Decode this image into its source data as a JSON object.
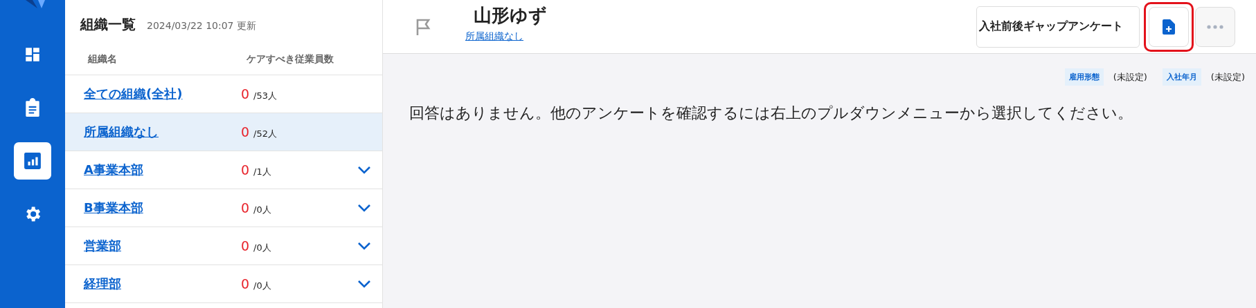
{
  "nav": [
    {
      "kind": "dashboard",
      "selected": false
    },
    {
      "kind": "clipboard",
      "selected": false
    },
    {
      "kind": "chart",
      "selected": true
    },
    {
      "kind": "settings",
      "selected": false
    }
  ],
  "org_list": {
    "title": "組織一覧",
    "updated": "2024/03/22 10:07 更新",
    "columns": [
      "組織名",
      "ケアすべき従業員数"
    ],
    "rows": [
      {
        "name": "全ての組織(全社)",
        "count": "0",
        "total": "/53人",
        "selected": false,
        "kind": "leaf"
      },
      {
        "name": "所属組織なし",
        "count": "0",
        "total": "/52人",
        "selected": true,
        "kind": "leaf"
      },
      {
        "name": "A事業本部",
        "count": "0",
        "total": "/1人",
        "selected": false,
        "kind": "group",
        "expanded": false
      },
      {
        "name": "B事業本部",
        "count": "0",
        "total": "/0人",
        "selected": false,
        "kind": "group",
        "expanded": false
      },
      {
        "name": "営業部",
        "count": "0",
        "total": "/0人",
        "selected": false,
        "kind": "group",
        "expanded": false
      },
      {
        "name": "経理部",
        "count": "0",
        "total": "/0人",
        "selected": false,
        "kind": "group",
        "expanded": false
      }
    ]
  },
  "employee": {
    "name": "山形ゆず",
    "organization": "所属組織なし",
    "flagged": false
  },
  "survey_select": {
    "value": "入社前後ギャップアンケート"
  },
  "new_document_button": {
    "highlighted": true
  },
  "attributes": [
    {
      "label": "雇用形態",
      "value": "(未設定)"
    },
    {
      "label": "入社年月",
      "value": "(未設定)"
    }
  ],
  "message": "回答はありません。他のアンケートを確認するには右上のプルダウンメニューから選択してください。"
}
